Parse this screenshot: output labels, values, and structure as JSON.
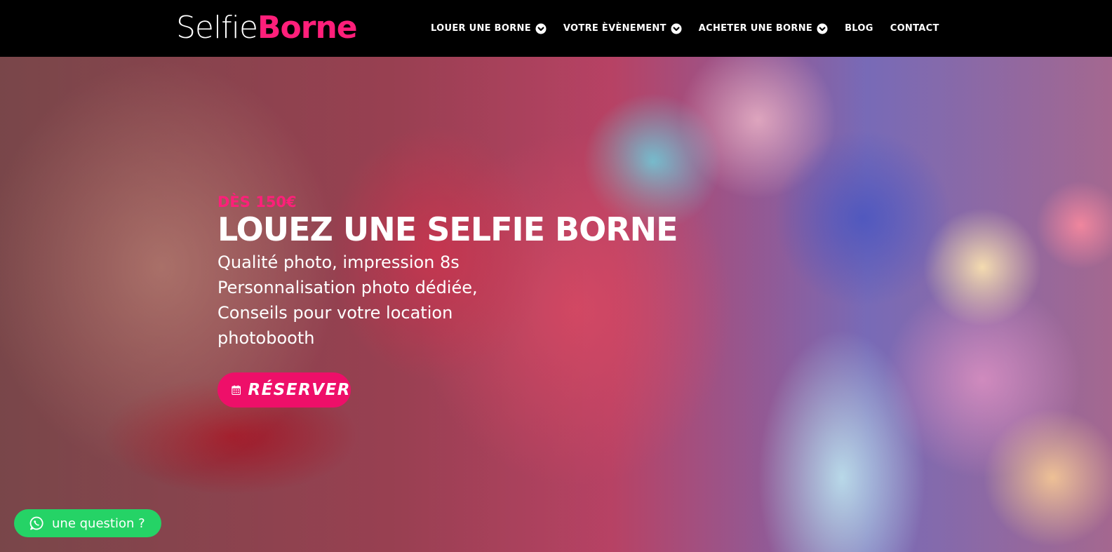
{
  "header": {
    "logo": {
      "part1": "Selfie",
      "part2": "Borne"
    },
    "nav": [
      {
        "label": "LOUER UNE BORNE",
        "icon": "chevron-down-circle-icon",
        "has_dropdown": true
      },
      {
        "label": "VOTRE ÈVÈNEMENT",
        "icon": "chevron-down-circle-icon",
        "has_dropdown": true
      },
      {
        "label": "ACHETER UNE BORNE",
        "icon": "chevron-down-circle-icon",
        "has_dropdown": true
      },
      {
        "label": "BLOG",
        "has_dropdown": false
      },
      {
        "label": "CONTACT",
        "has_dropdown": false
      }
    ]
  },
  "hero": {
    "price": "DÈS 150€",
    "headline": "LOUEZ UNE SELFIE BORNE",
    "subtitle_lines": [
      "Qualité photo, impression 8s",
      "Personnalisation photo dédiée,",
      "Conseils pour votre location",
      "photobooth"
    ],
    "cta": {
      "label": "RÉSERVER",
      "icon": "calendar-icon"
    }
  },
  "chat_widget": {
    "label": "une question ?",
    "icon": "whatsapp-icon"
  },
  "colors": {
    "accent_pink": "#ee0f69",
    "logo_pink": "#ff1f7a",
    "whatsapp_green": "#25d366",
    "header_bg": "#000000"
  }
}
